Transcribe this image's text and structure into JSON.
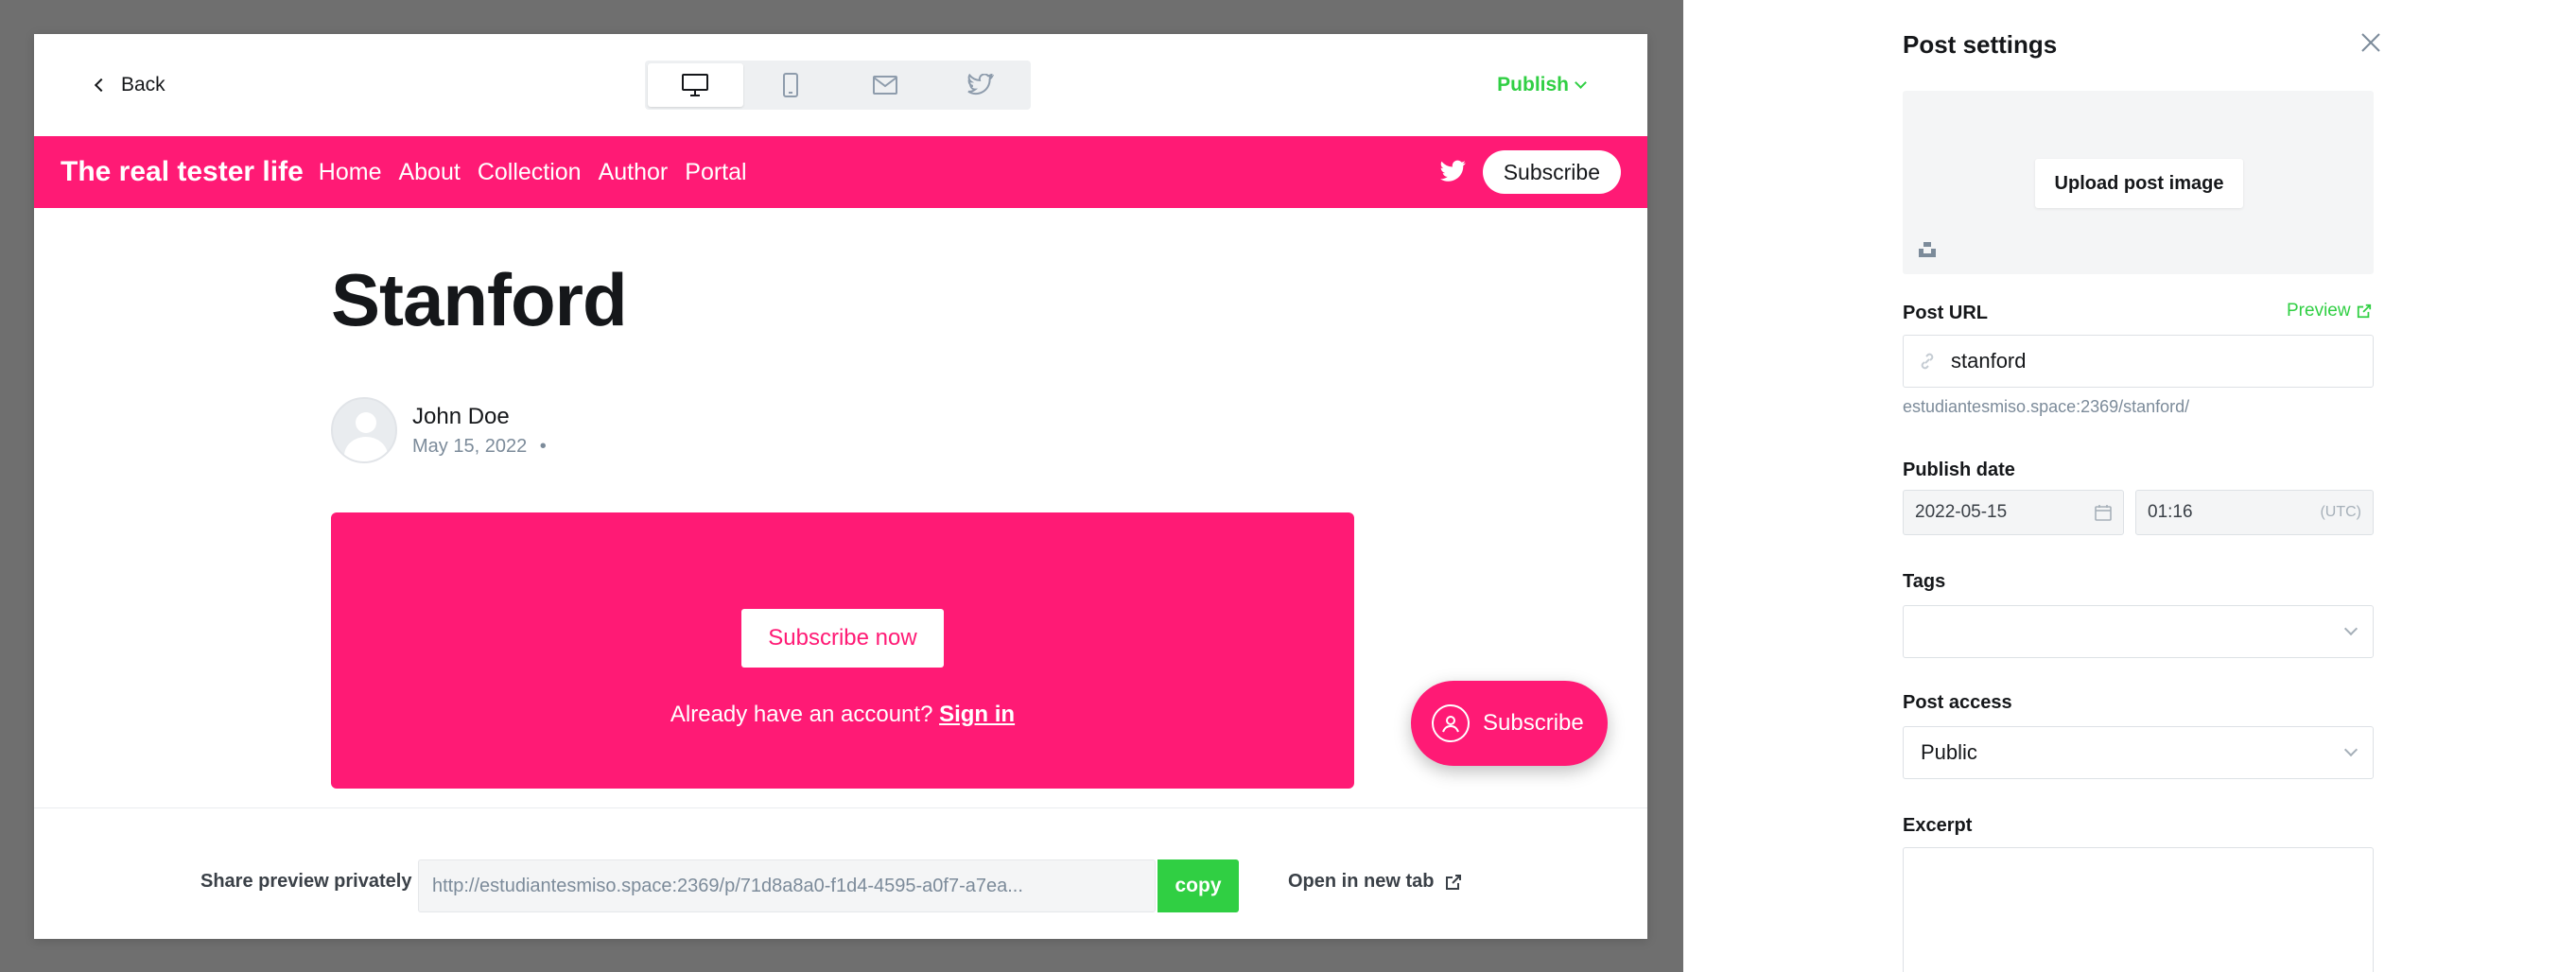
{
  "preview_header": {
    "back_label": "Back",
    "publish_label": "Publish",
    "devices": [
      "desktop-icon",
      "mobile-icon",
      "email-icon",
      "twitter-icon"
    ],
    "active_device": "desktop"
  },
  "site": {
    "title": "The real tester life",
    "nav": [
      "Home",
      "About",
      "Collection",
      "Author",
      "Portal"
    ],
    "subscribe_label": "Subscribe",
    "accent_color": "#ff1a75"
  },
  "post": {
    "title": "Stanford",
    "author": "John Doe",
    "date": "May 15, 2022",
    "date_separator": "•"
  },
  "cta": {
    "button_label": "Subscribe now",
    "signin_prefix": "Already have an account?",
    "signin_link": "Sign in"
  },
  "floating_subscribe": {
    "label": "Subscribe"
  },
  "share": {
    "label": "Share preview privately",
    "url": "http://estudiantesmiso.space:2369/p/71d8a8a0-f1d4-4595-a0f7-a7ea...",
    "copy_label": "copy",
    "open_label": "Open in new tab"
  },
  "settings": {
    "title": "Post settings",
    "upload_label": "Upload post image",
    "post_url_label": "Post URL",
    "preview_label": "Preview",
    "slug": "stanford",
    "url_hint": "estudiantesmiso.space:2369/stanford/",
    "publish_date_label": "Publish date",
    "date_value": "2022-05-15",
    "time_value": "01:16",
    "tz": "(UTC)",
    "tags_label": "Tags",
    "tags_value": "",
    "access_label": "Post access",
    "access_value": "Public",
    "excerpt_label": "Excerpt",
    "excerpt_value": "",
    "brand_color": "#30cf43"
  }
}
